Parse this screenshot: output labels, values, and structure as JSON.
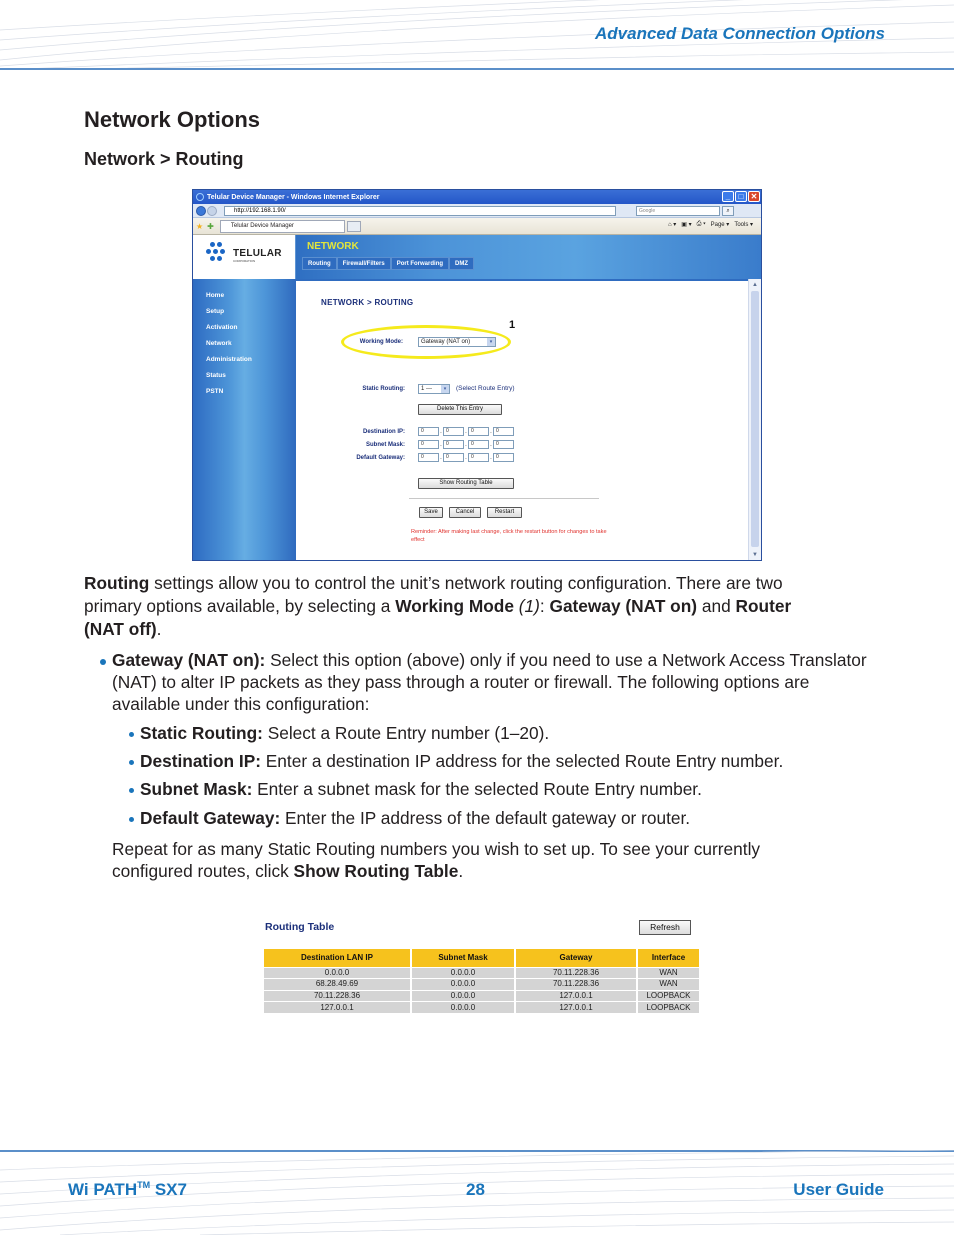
{
  "header": {
    "section_title": "Advanced Data Connection Options"
  },
  "page": {
    "title": "Network Options",
    "subtitle": "Network > Routing"
  },
  "browser": {
    "window_title": "Telular Device Manager - Windows Internet Explorer",
    "url": "http://192.168.1.90/",
    "search_placeholder": "Google",
    "tab_label": "Telular Device Manager",
    "command_bar": {
      "page_label": "Page ▾",
      "tools_label": "Tools ▾"
    },
    "window_buttons": {
      "minimize": "_",
      "maximize": "□",
      "close": "✕"
    }
  },
  "device_app": {
    "logo_text": "TELULAR",
    "logo_sub": "CORPORATION",
    "section_name": "NETWORK",
    "subtabs": [
      "Routing",
      "Firewall/Filters",
      "Port Forwarding",
      "DMZ"
    ],
    "nav_items": [
      "Home",
      "Setup",
      "Activation",
      "Network",
      "Administration",
      "Status",
      "PSTN"
    ],
    "content_title": "NETWORK > ROUTING",
    "callout_number": "1",
    "working_mode": {
      "label": "Working Mode:",
      "value": "Gateway (NAT on)"
    },
    "static_routing": {
      "label": "Static Routing:",
      "value": "1 ---",
      "hint": "(Select Route Entry)"
    },
    "delete_button": "Delete This Entry",
    "destination_ip": {
      "label": "Destination IP:",
      "octets": [
        "0",
        "0",
        "0",
        "0"
      ]
    },
    "subnet_mask": {
      "label": "Subnet Mask:",
      "octets": [
        "0",
        "0",
        "0",
        "0"
      ]
    },
    "default_gateway": {
      "label": "Default Gateway:",
      "octets": [
        "0",
        "0",
        "0",
        "0"
      ]
    },
    "show_routing_button": "Show Routing Table",
    "save_button": "Save",
    "cancel_button": "Cancel",
    "restart_button": "Restart",
    "reminder": "Reminder: After making last change, click the restart button for changes to take effect"
  },
  "body": {
    "intro": {
      "b1": "Routing",
      "t1": " settings allow you to control the unit’s network routing configuration. There are two primary options available, by selecting a ",
      "b2": "Working Mode",
      "i1": " (1)",
      "t2": ": ",
      "b3": "Gateway (NAT on)",
      "t3": " and ",
      "b4": "Router (NAT off)",
      "t4": "."
    },
    "gateway_bullet": {
      "bold": "Gateway (NAT on):",
      "text": " Select this option (above) only if you need to use a Network Access Translator (NAT) to alter IP packets as they pass through a router or firewall. The following options are available under this configuration:"
    },
    "sub_bullets": [
      {
        "bold": "Static Routing:",
        "text": " Select a Route Entry number (1–20)."
      },
      {
        "bold": "Destination IP:",
        "text": " Enter a destination IP address for the selected Route Entry number."
      },
      {
        "bold": "Subnet Mask:",
        "text": " Enter a subnet mask for the selected Route Entry number."
      },
      {
        "bold": "Default Gateway:",
        "text": " Enter the IP address of the default gateway or router."
      }
    ],
    "repeat": {
      "text": "Repeat for as many Static Routing numbers you wish to set up. To see your currently configured routes, click ",
      "bold": "Show Routing Table",
      "end": "."
    }
  },
  "routing_table": {
    "title": "Routing Table",
    "refresh_button": "Refresh",
    "columns": [
      "Destination LAN IP",
      "Subnet Mask",
      "Gateway",
      "Interface"
    ],
    "rows": [
      [
        "0.0.0.0",
        "0.0.0.0",
        "70.11.228.36",
        "WAN"
      ],
      [
        "68.28.49.69",
        "0.0.0.0",
        "70.11.228.36",
        "WAN"
      ],
      [
        "70.11.228.36",
        "0.0.0.0",
        "127.0.0.1",
        "LOOPBACK"
      ],
      [
        "127.0.0.1",
        "0.0.0.0",
        "127.0.0.1",
        "LOOPBACK"
      ]
    ]
  },
  "footer": {
    "product": "Wi PATH",
    "product_tm": "TM",
    "product_model": " SX7",
    "page_number": "28",
    "guide": "User Guide"
  }
}
